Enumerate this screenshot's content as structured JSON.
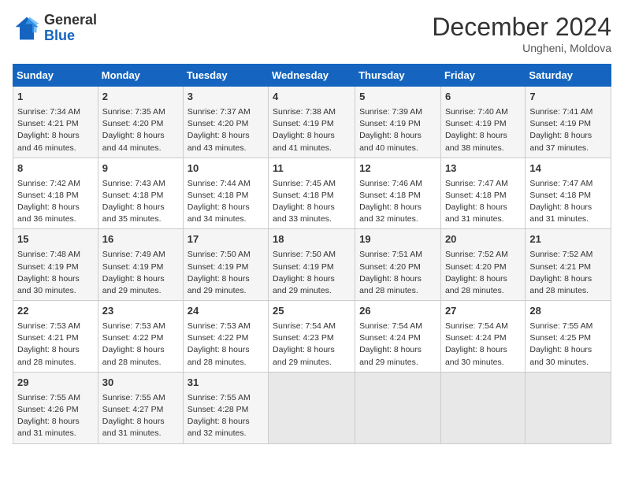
{
  "header": {
    "logo_line1": "General",
    "logo_line2": "Blue",
    "month_title": "December 2024",
    "subtitle": "Ungheni, Moldova"
  },
  "days_of_week": [
    "Sunday",
    "Monday",
    "Tuesday",
    "Wednesday",
    "Thursday",
    "Friday",
    "Saturday"
  ],
  "weeks": [
    [
      {
        "day": "1",
        "sunrise": "Sunrise: 7:34 AM",
        "sunset": "Sunset: 4:21 PM",
        "daylight": "Daylight: 8 hours and 46 minutes."
      },
      {
        "day": "2",
        "sunrise": "Sunrise: 7:35 AM",
        "sunset": "Sunset: 4:20 PM",
        "daylight": "Daylight: 8 hours and 44 minutes."
      },
      {
        "day": "3",
        "sunrise": "Sunrise: 7:37 AM",
        "sunset": "Sunset: 4:20 PM",
        "daylight": "Daylight: 8 hours and 43 minutes."
      },
      {
        "day": "4",
        "sunrise": "Sunrise: 7:38 AM",
        "sunset": "Sunset: 4:19 PM",
        "daylight": "Daylight: 8 hours and 41 minutes."
      },
      {
        "day": "5",
        "sunrise": "Sunrise: 7:39 AM",
        "sunset": "Sunset: 4:19 PM",
        "daylight": "Daylight: 8 hours and 40 minutes."
      },
      {
        "day": "6",
        "sunrise": "Sunrise: 7:40 AM",
        "sunset": "Sunset: 4:19 PM",
        "daylight": "Daylight: 8 hours and 38 minutes."
      },
      {
        "day": "7",
        "sunrise": "Sunrise: 7:41 AM",
        "sunset": "Sunset: 4:19 PM",
        "daylight": "Daylight: 8 hours and 37 minutes."
      }
    ],
    [
      {
        "day": "8",
        "sunrise": "Sunrise: 7:42 AM",
        "sunset": "Sunset: 4:18 PM",
        "daylight": "Daylight: 8 hours and 36 minutes."
      },
      {
        "day": "9",
        "sunrise": "Sunrise: 7:43 AM",
        "sunset": "Sunset: 4:18 PM",
        "daylight": "Daylight: 8 hours and 35 minutes."
      },
      {
        "day": "10",
        "sunrise": "Sunrise: 7:44 AM",
        "sunset": "Sunset: 4:18 PM",
        "daylight": "Daylight: 8 hours and 34 minutes."
      },
      {
        "day": "11",
        "sunrise": "Sunrise: 7:45 AM",
        "sunset": "Sunset: 4:18 PM",
        "daylight": "Daylight: 8 hours and 33 minutes."
      },
      {
        "day": "12",
        "sunrise": "Sunrise: 7:46 AM",
        "sunset": "Sunset: 4:18 PM",
        "daylight": "Daylight: 8 hours and 32 minutes."
      },
      {
        "day": "13",
        "sunrise": "Sunrise: 7:47 AM",
        "sunset": "Sunset: 4:18 PM",
        "daylight": "Daylight: 8 hours and 31 minutes."
      },
      {
        "day": "14",
        "sunrise": "Sunrise: 7:47 AM",
        "sunset": "Sunset: 4:18 PM",
        "daylight": "Daylight: 8 hours and 31 minutes."
      }
    ],
    [
      {
        "day": "15",
        "sunrise": "Sunrise: 7:48 AM",
        "sunset": "Sunset: 4:19 PM",
        "daylight": "Daylight: 8 hours and 30 minutes."
      },
      {
        "day": "16",
        "sunrise": "Sunrise: 7:49 AM",
        "sunset": "Sunset: 4:19 PM",
        "daylight": "Daylight: 8 hours and 29 minutes."
      },
      {
        "day": "17",
        "sunrise": "Sunrise: 7:50 AM",
        "sunset": "Sunset: 4:19 PM",
        "daylight": "Daylight: 8 hours and 29 minutes."
      },
      {
        "day": "18",
        "sunrise": "Sunrise: 7:50 AM",
        "sunset": "Sunset: 4:19 PM",
        "daylight": "Daylight: 8 hours and 29 minutes."
      },
      {
        "day": "19",
        "sunrise": "Sunrise: 7:51 AM",
        "sunset": "Sunset: 4:20 PM",
        "daylight": "Daylight: 8 hours and 28 minutes."
      },
      {
        "day": "20",
        "sunrise": "Sunrise: 7:52 AM",
        "sunset": "Sunset: 4:20 PM",
        "daylight": "Daylight: 8 hours and 28 minutes."
      },
      {
        "day": "21",
        "sunrise": "Sunrise: 7:52 AM",
        "sunset": "Sunset: 4:21 PM",
        "daylight": "Daylight: 8 hours and 28 minutes."
      }
    ],
    [
      {
        "day": "22",
        "sunrise": "Sunrise: 7:53 AM",
        "sunset": "Sunset: 4:21 PM",
        "daylight": "Daylight: 8 hours and 28 minutes."
      },
      {
        "day": "23",
        "sunrise": "Sunrise: 7:53 AM",
        "sunset": "Sunset: 4:22 PM",
        "daylight": "Daylight: 8 hours and 28 minutes."
      },
      {
        "day": "24",
        "sunrise": "Sunrise: 7:53 AM",
        "sunset": "Sunset: 4:22 PM",
        "daylight": "Daylight: 8 hours and 28 minutes."
      },
      {
        "day": "25",
        "sunrise": "Sunrise: 7:54 AM",
        "sunset": "Sunset: 4:23 PM",
        "daylight": "Daylight: 8 hours and 29 minutes."
      },
      {
        "day": "26",
        "sunrise": "Sunrise: 7:54 AM",
        "sunset": "Sunset: 4:24 PM",
        "daylight": "Daylight: 8 hours and 29 minutes."
      },
      {
        "day": "27",
        "sunrise": "Sunrise: 7:54 AM",
        "sunset": "Sunset: 4:24 PM",
        "daylight": "Daylight: 8 hours and 30 minutes."
      },
      {
        "day": "28",
        "sunrise": "Sunrise: 7:55 AM",
        "sunset": "Sunset: 4:25 PM",
        "daylight": "Daylight: 8 hours and 30 minutes."
      }
    ],
    [
      {
        "day": "29",
        "sunrise": "Sunrise: 7:55 AM",
        "sunset": "Sunset: 4:26 PM",
        "daylight": "Daylight: 8 hours and 31 minutes."
      },
      {
        "day": "30",
        "sunrise": "Sunrise: 7:55 AM",
        "sunset": "Sunset: 4:27 PM",
        "daylight": "Daylight: 8 hours and 31 minutes."
      },
      {
        "day": "31",
        "sunrise": "Sunrise: 7:55 AM",
        "sunset": "Sunset: 4:28 PM",
        "daylight": "Daylight: 8 hours and 32 minutes."
      },
      null,
      null,
      null,
      null
    ]
  ]
}
